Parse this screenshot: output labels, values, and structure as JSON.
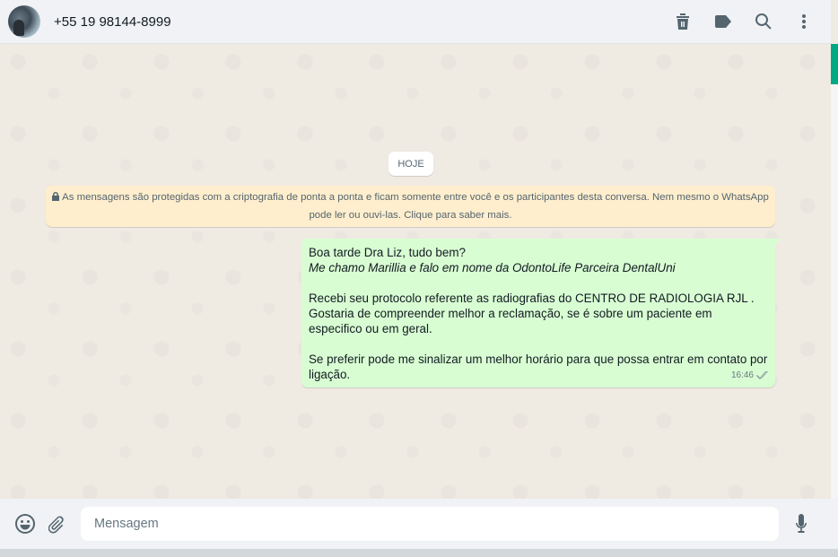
{
  "header": {
    "contact_name": "+55 19 98144-8999",
    "icons": [
      "delete-icon",
      "label-icon",
      "search-icon",
      "menu-icon"
    ]
  },
  "chat": {
    "date_divider": "HOJE",
    "encryption_notice": {
      "line1": "As mensagens são protegidas com a criptografia de ponta a ponta e ficam somente entre você e os participantes desta conversa. Nem mesmo o WhatsApp",
      "line2": "pode ler ou ouvi-las. Clique para saber mais."
    },
    "message": {
      "line1": "Boa tarde Dra Liz, tudo bem?",
      "line2": "Me chamo Marillia e falo em nome da OdontoLife Parceira DentalUni",
      "line3": "Recebi seu protocolo referente as radiografias do CENTRO DE RADIOLOGIA RJL .",
      "line4": "Gostaria de compreender melhor a reclamação, se é sobre um paciente em especifico ou em geral.",
      "line5": "Se preferir pode me sinalizar um melhor horário para que possa entrar em contato por ligação.",
      "time": "16:46",
      "status": "read"
    }
  },
  "footer": {
    "placeholder": "Mensagem"
  },
  "colors": {
    "accent": "#00a884",
    "outgoing_bubble": "#d9fdd3",
    "notice_bg": "#ffeecd",
    "chat_bg": "#efeae2"
  }
}
